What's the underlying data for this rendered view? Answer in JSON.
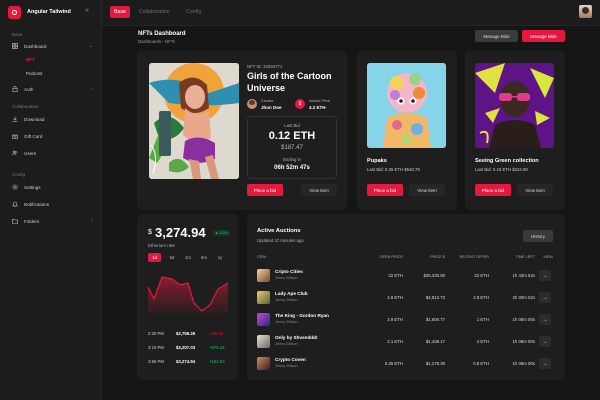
{
  "brand": {
    "name": "Angular Tailwind"
  },
  "sidebar": {
    "sections": [
      {
        "title": "Base"
      },
      {
        "title": "Collaboration"
      },
      {
        "title": "Config"
      }
    ],
    "items": [
      {
        "label": "Dashboard",
        "icon": "dashboard-icon"
      },
      {
        "label": "Auth",
        "icon": "lock-icon"
      },
      {
        "label": "Download",
        "icon": "download-icon"
      },
      {
        "label": "Gift Card",
        "icon": "gift-icon"
      },
      {
        "label": "Users",
        "icon": "users-icon"
      },
      {
        "label": "Settings",
        "icon": "gear-icon"
      },
      {
        "label": "Notifications",
        "icon": "bell-icon"
      },
      {
        "label": "Folders",
        "icon": "folder-icon"
      }
    ],
    "subitems": [
      {
        "label": "NFT"
      },
      {
        "label": "Podcast"
      }
    ]
  },
  "topbar": {
    "tabs": [
      {
        "label": "Base"
      },
      {
        "label": "Collaboration"
      },
      {
        "label": "Config"
      }
    ]
  },
  "header": {
    "title": "NFTs Dashboard",
    "breadcrumb": "Dashboards  ›  NFTs",
    "manage_bids_label": "Manage Bids",
    "manage_bids_red_label": "Manage Bids"
  },
  "featured": {
    "nft_id": "NFT ID: 34356771",
    "title_line1": "Girls of the Cartoon",
    "title_line2": "Universe",
    "creator_label": "Creator",
    "creator_name": "Jhon Doe",
    "instant_label": "Instant Price",
    "instant_price": "4.2 ETH",
    "last_bid_label": "Last Bid",
    "last_bid_eth": "0.12 ETH",
    "last_bid_usd": "$187.47",
    "ending_label": "Ending in",
    "ending_time": "06h 52m 47s",
    "place_bid_label": "Place a bid",
    "view_item_label": "View item"
  },
  "nft_cards": [
    {
      "title": "Pupaks",
      "bid": "Last Bid: 0.35 ETH $548.79",
      "place": "Place a bid",
      "view": "View item"
    },
    {
      "title": "Seeing Green collection",
      "bid": "Last Bid: 0.15 ETH $234.88",
      "place": "Place a bid",
      "view": "View item"
    }
  ],
  "price_card": {
    "currency": "$",
    "price": "3,274.94",
    "change": "▲ 5.3%",
    "label": "Etherium rate",
    "ranges": [
      "1d",
      "5d",
      "1m",
      "6m",
      "1y"
    ],
    "history": [
      {
        "time": "2:30 PM",
        "price": "$2,756.26",
        "diff": "-139.34",
        "dir": "down"
      },
      {
        "time": "3:10 PM",
        "price": "$3,207.03",
        "diff": "+576.24",
        "dir": "up"
      },
      {
        "time": "3:55 PM",
        "price": "$3,274.94",
        "diff": "+124.03",
        "dir": "up"
      }
    ]
  },
  "auctions": {
    "title": "Active Auctions",
    "updated": "Updated 37 minutes ago",
    "history_label": "History",
    "columns": [
      "ITEM",
      "OPEN PRICE",
      "PRICE $",
      "RECENT OFFER",
      "TIME LEFT",
      "VIEW"
    ],
    "rows": [
      {
        "name": "Cripto Cities",
        "owner": "Jenny Wilson",
        "open": "22 ETH",
        "price": "$35,330.90",
        "offer": "22 ETH",
        "time": "1h 43m 52s"
      },
      {
        "name": "Lady Ape Club",
        "owner": "Jenny Wilson",
        "open": "2.8 ETH",
        "price": "$4,812.72",
        "offer": "2.8 ETH",
        "time": "2h 00m 02s"
      },
      {
        "name": "The King - Gordon Ryan",
        "owner": "Jenny Wilson",
        "open": "2.9 ETH",
        "price": "$1,600.77",
        "offer": "1 ETH",
        "time": "1h 05m 00s"
      },
      {
        "name": "Only by Shvembldr",
        "owner": "Jenny Wilson",
        "open": "2.1 ETH",
        "price": "$1,438.17",
        "offer": "2 ETH",
        "time": "1h 05m 00s"
      },
      {
        "name": "Crypto Coven",
        "owner": "Jenny Wilson",
        "open": "0.35 ETH",
        "price": "$1,278.30",
        "offer": "0.8 ETH",
        "time": "1h 05m 00s"
      }
    ]
  },
  "colors": {
    "accent": "#e3193e",
    "bg": "#151515",
    "card": "#1e1e1e",
    "up": "#22c55e",
    "down": "#e3193e"
  }
}
